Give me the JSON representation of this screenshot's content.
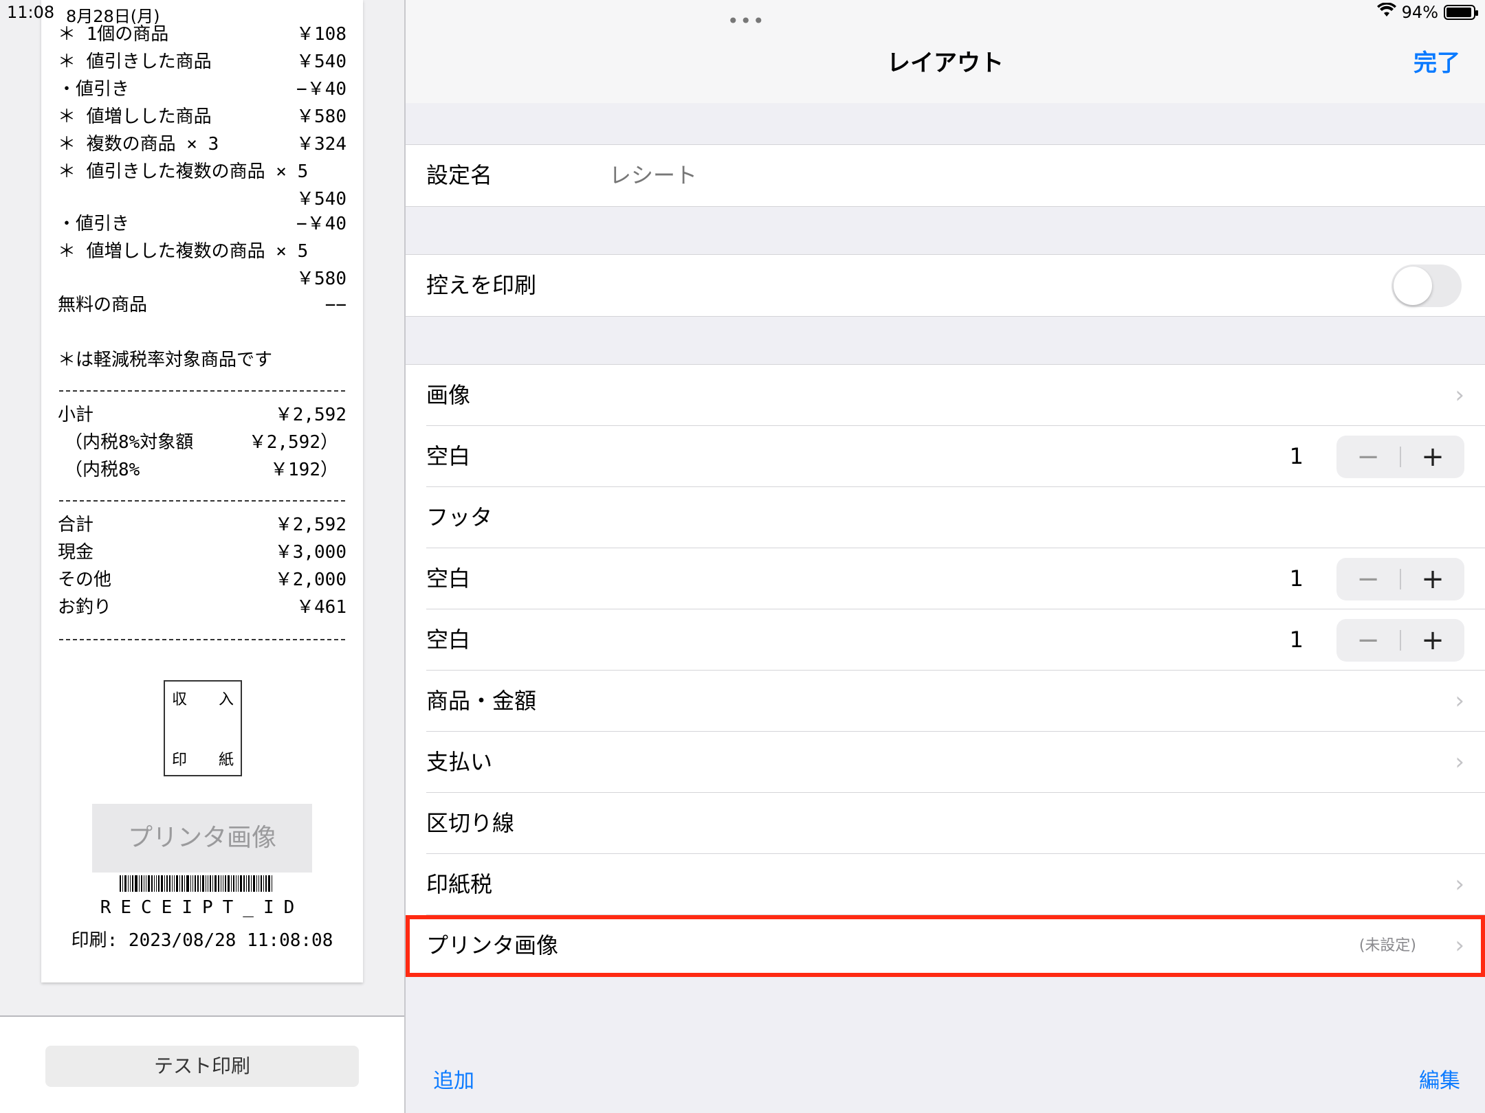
{
  "status": {
    "time": "11:08",
    "date": "8月28日(月)",
    "battery": "94%",
    "multitask_dots": "•••"
  },
  "receipt": {
    "lines": [
      {
        "left": "＊ 1個の商品",
        "right": "￥108"
      },
      {
        "left": "＊ 値引きした商品",
        "right": "￥540"
      },
      {
        "left": "・値引き",
        "right": "−￥40"
      },
      {
        "left": "＊ 値増しした商品",
        "right": "￥580"
      },
      {
        "left": "＊ 複数の商品 × 3",
        "right": "￥324"
      },
      {
        "left": "＊ 値引きした複数の商品 × 5",
        "right": ""
      },
      {
        "left": "",
        "right": "￥540"
      },
      {
        "left": "・値引き",
        "right": "−￥40"
      },
      {
        "left": "＊ 値増しした複数の商品 × 5",
        "right": ""
      },
      {
        "left": "",
        "right": "￥580"
      },
      {
        "left": "無料の商品",
        "right": "−−"
      }
    ],
    "tax_note": "＊は軽減税率対象商品です",
    "subtotal_lines": [
      {
        "left": "小計",
        "right": "￥2,592"
      },
      {
        "left": "（内税8%対象額",
        "right": "￥2,592）"
      },
      {
        "left": "（内税8%",
        "right": "￥192）"
      }
    ],
    "total_lines": [
      {
        "left": "合計",
        "right": "￥2,592"
      },
      {
        "left": "現金",
        "right": "￥3,000"
      },
      {
        "left": "その他",
        "right": "￥2,000"
      },
      {
        "left": "お釣り",
        "right": "￥461"
      }
    ],
    "stamp": {
      "tl": "収",
      "tr": "入",
      "bl": "印",
      "br": "紙"
    },
    "printer_image_placeholder": "プリンタ画像",
    "receipt_id": "RECEIPT_ID",
    "printed_at": "印刷: 2023/08/28 11:08:08"
  },
  "test_print_label": "テスト印刷",
  "nav": {
    "title": "レイアウト",
    "done": "完了"
  },
  "settings": {
    "name_label": "設定名",
    "name_value": "レシート",
    "copy_print_label": "控えを印刷",
    "copy_print_on": false,
    "items": [
      {
        "label": "画像",
        "type": "chevron"
      },
      {
        "label": "空白",
        "type": "stepper",
        "value": "1"
      },
      {
        "label": "フッタ",
        "type": "plain"
      },
      {
        "label": "空白",
        "type": "stepper",
        "value": "1"
      },
      {
        "label": "空白",
        "type": "stepper",
        "value": "1"
      },
      {
        "label": "商品・金額",
        "type": "chevron"
      },
      {
        "label": "支払い",
        "type": "chevron"
      },
      {
        "label": "区切り線",
        "type": "plain"
      },
      {
        "label": "印紙税",
        "type": "chevron"
      },
      {
        "label": "プリンタ画像",
        "type": "chevron",
        "note": "(未設定)"
      }
    ]
  },
  "icons": {
    "chevron": "›",
    "minus": "−",
    "plus": "+"
  },
  "toolbar": {
    "add": "追加",
    "edit": "編集"
  },
  "colors": {
    "accent": "#0a7aff",
    "highlight": "#ff2a12"
  }
}
